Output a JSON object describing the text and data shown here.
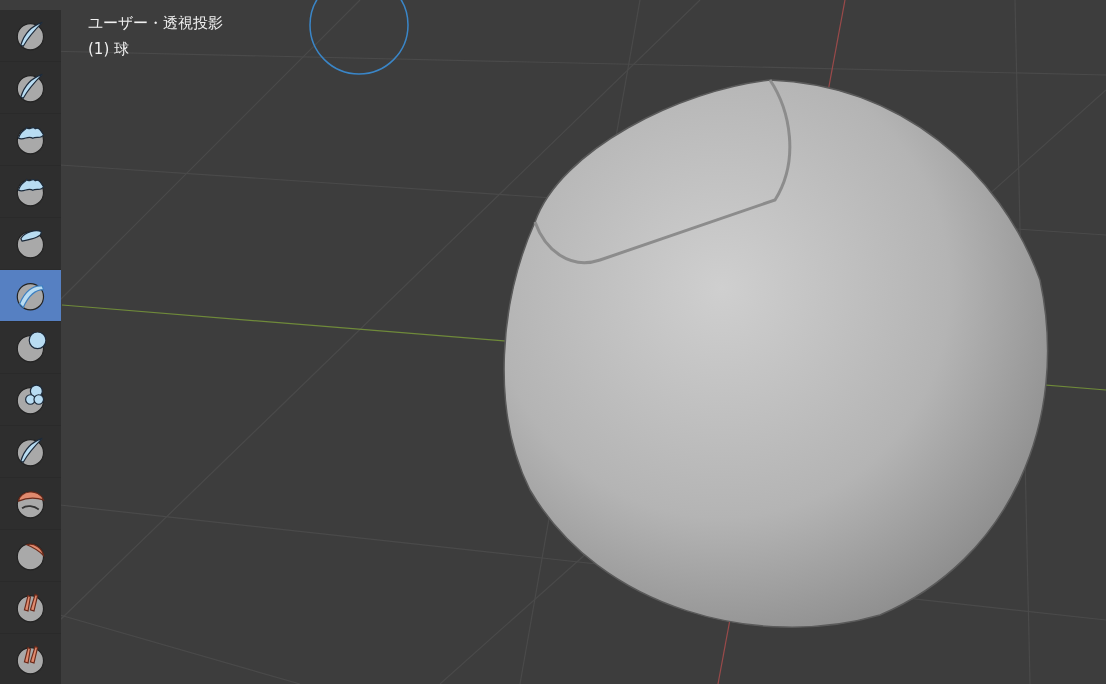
{
  "viewport": {
    "view_name": "ユーザー・透視投影",
    "object_name": "(1) 球"
  },
  "toolbar": {
    "tools": [
      {
        "kind": "stroke",
        "selected": false
      },
      {
        "kind": "stroke",
        "selected": false
      },
      {
        "kind": "wave",
        "selected": false
      },
      {
        "kind": "wave",
        "selected": false
      },
      {
        "kind": "bump",
        "selected": false
      },
      {
        "kind": "band",
        "selected": true
      },
      {
        "kind": "bulge",
        "selected": false
      },
      {
        "kind": "cluster",
        "selected": false
      },
      {
        "kind": "stroke",
        "selected": false
      },
      {
        "kind": "rough-cap",
        "selected": false
      },
      {
        "kind": "cap",
        "selected": false
      },
      {
        "kind": "fingers",
        "selected": false
      },
      {
        "kind": "fingers",
        "selected": false
      }
    ]
  }
}
